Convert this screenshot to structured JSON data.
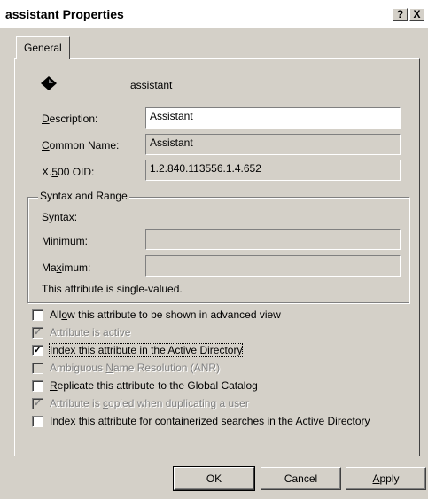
{
  "window": {
    "title": "assistant Properties",
    "help_glyph": "?",
    "close_glyph": "X"
  },
  "tabs": [
    {
      "label": "General"
    }
  ],
  "header": {
    "name": "assistant",
    "icon": "attribute-icon"
  },
  "fields": {
    "description": {
      "label": "Description:",
      "value": "Assistant"
    },
    "common_name": {
      "label": "Common Name:",
      "value": "Assistant"
    },
    "x500_oid": {
      "label": "X.500 OID:",
      "value": "1.2.840.113556.1.4.652"
    }
  },
  "syntax_range": {
    "group_label": "Syntax and Range",
    "syntax_label": "Syntax:",
    "syntax_value": "",
    "minimum_label": "Minimum:",
    "minimum_value": "",
    "maximum_label": "Maximum:",
    "maximum_value": "",
    "note": "This attribute is single-valued."
  },
  "options": [
    {
      "label": "Allow this attribute to be shown in advanced view",
      "checked": false,
      "enabled": true
    },
    {
      "label": "Attribute is active",
      "checked": true,
      "enabled": false
    },
    {
      "label": "Index this attribute in the Active Directory",
      "checked": true,
      "enabled": true
    },
    {
      "label": "Ambiguous Name Resolution (ANR)",
      "checked": false,
      "enabled": false
    },
    {
      "label": "Replicate this attribute to the Global Catalog",
      "checked": false,
      "enabled": true
    },
    {
      "label": "Attribute is copied when duplicating a user",
      "checked": true,
      "enabled": false
    },
    {
      "label": "Index this attribute for containerized searches in the Active Directory",
      "checked": false,
      "enabled": true
    }
  ],
  "buttons": {
    "ok": "OK",
    "cancel": "Cancel",
    "apply": "Apply"
  }
}
